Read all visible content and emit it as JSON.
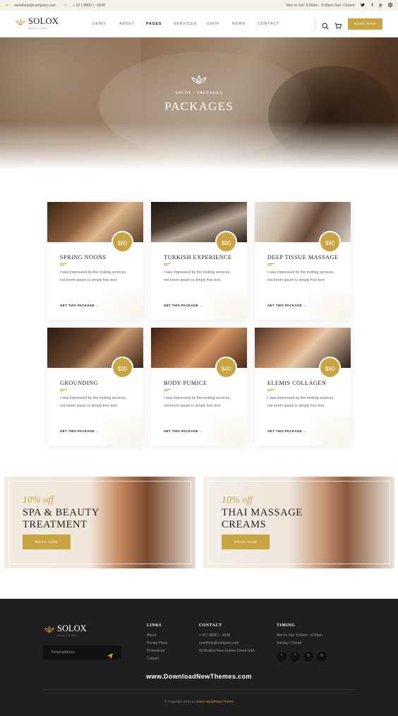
{
  "topbar": {
    "email": "needhelp@company.com",
    "phone": "+ 92 ( 8800 ) - 6930",
    "hours": "Mon to Sat: 9:00am - 6:00pm Sun: Closed"
  },
  "header": {
    "logo_text": "SOLOX",
    "logo_sub": "BEAUTY & SPA",
    "nav": [
      "DEMO",
      "ABOUT",
      "PAGES",
      "SERVICES",
      "SHOP",
      "NEWS",
      "CONTACT"
    ],
    "active_nav": "PAGES",
    "book_now": "BOOK NOW"
  },
  "hero": {
    "breadcrumb": "SOLOX  /  PACKAGES",
    "title": "PACKAGES"
  },
  "packages": [
    {
      "title": "SPRING NOONS",
      "price": "$60",
      "desc": "I was impressed by the moiling services, not lorem ipsum is simply free text.",
      "link": "GET THIS PACKAGE"
    },
    {
      "title": "TURKISH EXPERIENCE",
      "price": "$80",
      "desc": "I was impressed by the moiling services, not lorem ipsum is simply free text.",
      "link": "GET THIS PACKAGE"
    },
    {
      "title": "DEEP TISSUE MASSAGE",
      "price": "$90",
      "desc": "I was impressed by the moiling services, not lorem ipsum is simply free text.",
      "link": "GET THIS PACKAGE"
    },
    {
      "title": "GROUNDING",
      "price": "$30",
      "desc": "I was impressed by the moiling services, not lorem ipsum is simply free text.",
      "link": "GET THIS PACKAGE"
    },
    {
      "title": "BODY PUMICE",
      "price": "$40",
      "desc": "I was impressed by the moiling services, not lorem ipsum is simply free text.",
      "link": "GET THIS PACKAGE"
    },
    {
      "title": "ELEMIS COLLAGEN",
      "price": "$60",
      "desc": "I was impressed by the moiling services, not lorem ipsum is simply free text.",
      "link": "GET THIS PACKAGE"
    }
  ],
  "promos": [
    {
      "off": "10% off",
      "line1": "SPA & BEAUTY",
      "line2": "TREATMENT",
      "button": "BOOK NOW"
    },
    {
      "off": "10% off",
      "line1": "THAI MASSAGE",
      "line2": "CREAMS",
      "button": "BOOK NOW"
    }
  ],
  "footer": {
    "logo_text": "SOLOX",
    "logo_sub": "BEAUTY & SPA",
    "email_placeholder": "Email address",
    "links_title": "LINKS",
    "links": [
      "About",
      "Pricing Plans",
      "Promotions",
      "Contact"
    ],
    "contact_title": "CONTACT",
    "contact": [
      "+ 92 ( 8800 ) - 6930",
      "needhelp@company.com",
      "66 Broklyn New Golden Street USA"
    ],
    "timing_title": "TIMING",
    "timing": [
      "Mon to Sat: 9:00am - 6:00pm",
      "Sunday: Closed"
    ],
    "watermark": "www.DownloadNewThemes.com",
    "copyright_prefix": "© Copyright 2023 by",
    "copyright_link": "Solox WordPress Theme"
  },
  "colors": {
    "accent": "#c8a442",
    "footer_bg": "#1f1f1f",
    "topbar_bg": "#f6f1e8"
  }
}
